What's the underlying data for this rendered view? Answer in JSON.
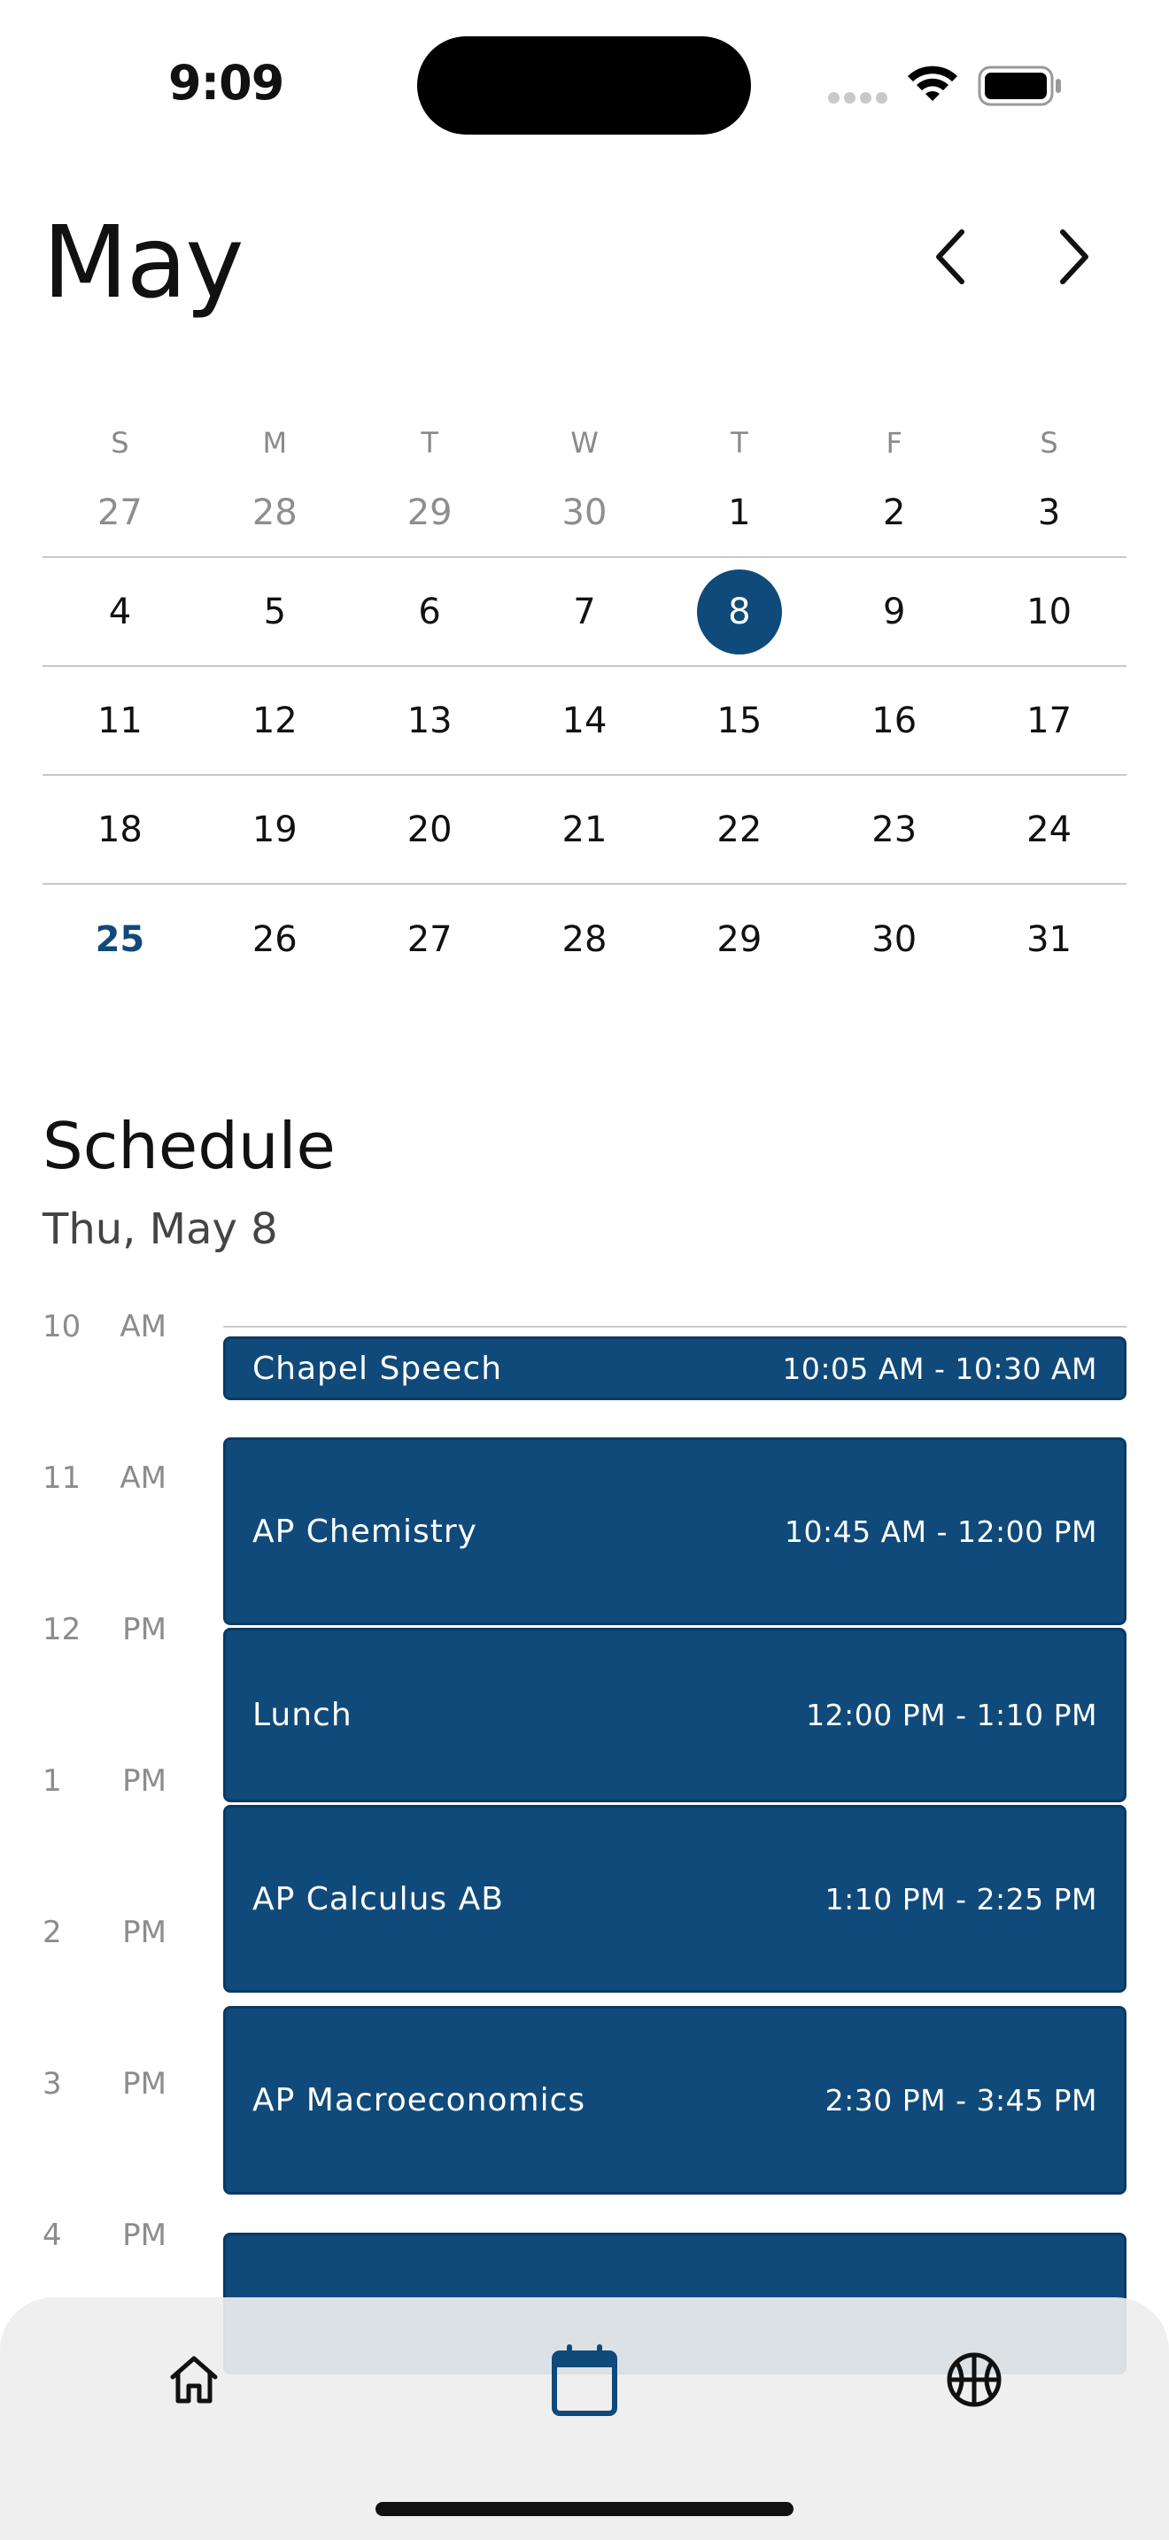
{
  "status_bar": {
    "time": "9:09"
  },
  "header": {
    "month": "May",
    "prev_icon": "chevron-left-icon",
    "next_icon": "chevron-right-icon"
  },
  "calendar": {
    "weekdays": [
      "S",
      "M",
      "T",
      "W",
      "T",
      "F",
      "S"
    ],
    "weeks": [
      [
        "27",
        "28",
        "29",
        "30",
        "1",
        "2",
        "3"
      ],
      [
        "4",
        "5",
        "6",
        "7",
        "8",
        "9",
        "10"
      ],
      [
        "11",
        "12",
        "13",
        "14",
        "15",
        "16",
        "17"
      ],
      [
        "18",
        "19",
        "20",
        "21",
        "22",
        "23",
        "24"
      ],
      [
        "25",
        "26",
        "27",
        "28",
        "29",
        "30",
        "31"
      ]
    ],
    "selected_day": "8",
    "highlighted_day": "25",
    "accent_color": "#0f4a7a"
  },
  "schedule": {
    "title": "Schedule",
    "date": "Thu, May 8",
    "hours": [
      {
        "num": "10",
        "ampm": "AM"
      },
      {
        "num": "11",
        "ampm": "AM"
      },
      {
        "num": "12",
        "ampm": "PM"
      },
      {
        "num": "1",
        "ampm": "PM"
      },
      {
        "num": "2",
        "ampm": "PM"
      },
      {
        "num": "3",
        "ampm": "PM"
      },
      {
        "num": "4",
        "ampm": "PM"
      }
    ],
    "events": [
      {
        "name": "Chapel Speech",
        "time": "10:05 AM - 10:30 AM"
      },
      {
        "name": "AP Chemistry",
        "time": "10:45 AM - 12:00 PM"
      },
      {
        "name": "Lunch",
        "time": "12:00 PM - 1:10 PM"
      },
      {
        "name": "AP Calculus AB",
        "time": "1:10 PM - 2:25 PM"
      },
      {
        "name": "AP Macroeconomics",
        "time": "2:30 PM - 3:45 PM"
      }
    ],
    "event_color": "#104a7a"
  },
  "tabbar": {
    "tabs": [
      {
        "icon": "home-icon"
      },
      {
        "icon": "calendar-icon",
        "active": true
      },
      {
        "icon": "basketball-icon"
      }
    ]
  }
}
